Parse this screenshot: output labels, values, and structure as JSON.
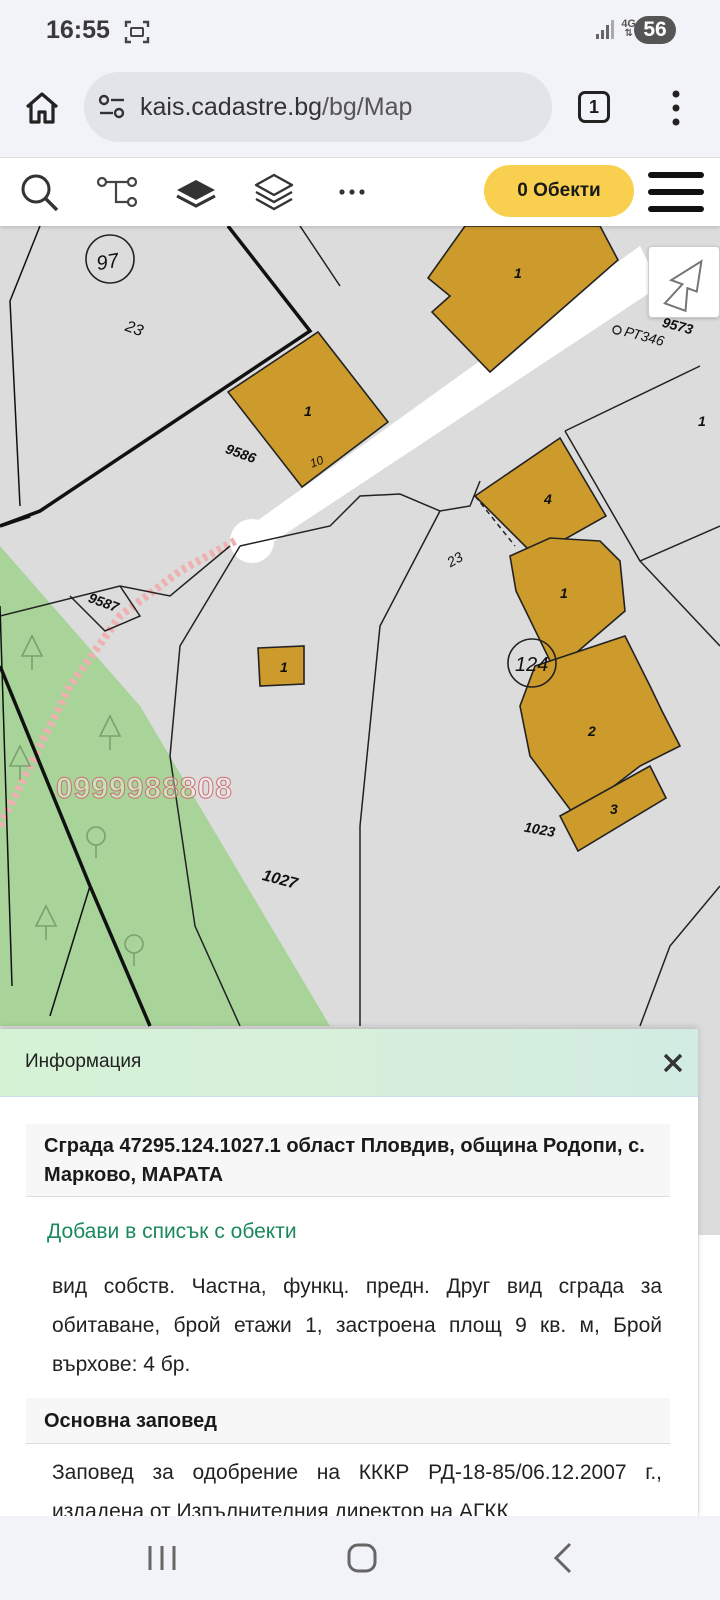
{
  "status_bar": {
    "time": "16:55",
    "network": "4G",
    "battery": "56"
  },
  "browser": {
    "url_host": "kais.cadastre.bg",
    "url_path": "/bg/Map",
    "tab_count": "1"
  },
  "toolbar": {
    "objects_label": "0 Обекти",
    "tools": [
      "search-icon",
      "route-icon",
      "layer-icon",
      "layers-stack-icon",
      "more-icon"
    ]
  },
  "map": {
    "labels": {
      "circle_97": "97",
      "circle_124": "124",
      "parcel_23_top": "23",
      "parcel_23_mid": "23",
      "parcel_9586": "9586",
      "parcel_9587": "9587",
      "parcel_9573": "9573",
      "parcel_1027": "1027",
      "parcel_1023": "1023",
      "point_pt346": "РТ346",
      "bldg_1_a": "1",
      "bldg_1_b": "1",
      "bldg_1_c": "1",
      "bldg_1_d": "1",
      "bldg_1_e": "1",
      "bldg_2": "2",
      "bldg_3": "3",
      "bldg_4": "4",
      "bldg_10": "10"
    },
    "watermark": "0999988808",
    "colors": {
      "background": "#dcdcdc",
      "building": "#cd9a2c",
      "green_area": "#a8d49a",
      "road": "#ffffff"
    }
  },
  "info_panel": {
    "title": "Информация",
    "building_title": "Сграда 47295.124.1027.1 област Пловдив, община Родопи, с. Марково, МАРАТА",
    "add_link": "Добави в списък с обекти",
    "details": "вид собств. Частна, функц. предн. Друг вид сграда за обитаване, брой етажи 1, застроена площ 9 кв. м, Брой върхове: 4 бр.",
    "order_header": "Основна заповед",
    "order_text": "Заповед за одобрение на КККР РД-18-85/06.12.2007 г., издадена от Изпълнителния директор на АГКК"
  }
}
